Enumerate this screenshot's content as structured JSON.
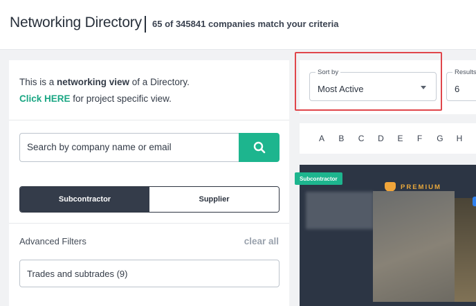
{
  "header": {
    "title": "Networking Directory",
    "count": "65 of 345841 companies match your criteria"
  },
  "intro": {
    "line1_a": "This is a ",
    "line1_bold": "networking view",
    "line1_b": " of a Directory.",
    "link": "Click HERE",
    "line2": " for project specific view."
  },
  "search": {
    "placeholder": "Search by company name or email"
  },
  "type_toggle": {
    "options": [
      "Subcontractor",
      "Supplier"
    ],
    "selected": "Subcontractor"
  },
  "filters": {
    "advanced_label": "Advanced Filters",
    "clear_all": "clear all",
    "trades": "Trades and subtrades (9)"
  },
  "sort": {
    "label": "Sort by",
    "value": "Most Active"
  },
  "results": {
    "label": "Results",
    "value": "6"
  },
  "alphabet": [
    "A",
    "B",
    "C",
    "D",
    "E",
    "F",
    "G",
    "H"
  ],
  "card": {
    "type_badge": "Subcontractor",
    "premium": "PREMIUM"
  },
  "colors": {
    "accent": "#1db58e",
    "dark": "#343c4a",
    "highlight": "#e0454a",
    "premium": "#e9a83c"
  }
}
